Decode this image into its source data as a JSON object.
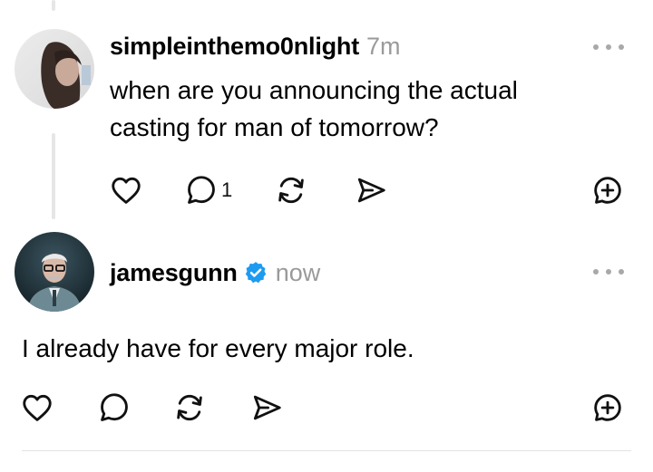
{
  "posts": [
    {
      "username": "simpleinthemo0nlight",
      "time": "7m",
      "text": "when are you announcing the actual casting for man of tomorrow?",
      "reply_count": "1",
      "verified": false
    },
    {
      "username": "jamesgunn",
      "time": "now",
      "text": "I already have for every major role.",
      "reply_count": "",
      "verified": true
    }
  ],
  "icons": {
    "like": "heart-icon",
    "reply": "comment-icon",
    "repost": "repost-icon",
    "share": "send-icon",
    "add": "add-icon",
    "more": "more-horizontal-icon",
    "verified": "verified-badge-icon"
  },
  "colors": {
    "verified": "#1d9bf0",
    "muted": "#9a9a9a",
    "text": "#000000"
  }
}
